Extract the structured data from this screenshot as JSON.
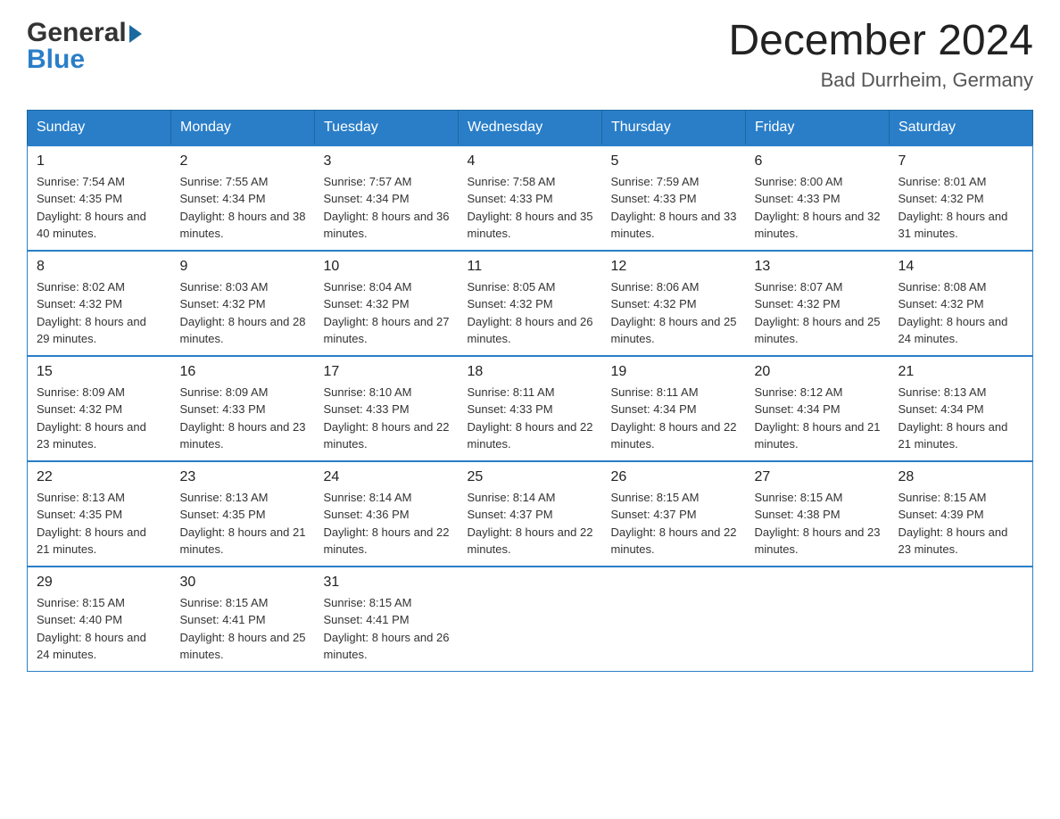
{
  "header": {
    "logo_general": "General",
    "logo_blue": "Blue",
    "title": "December 2024",
    "subtitle": "Bad Durrheim, Germany"
  },
  "calendar": {
    "days_of_week": [
      "Sunday",
      "Monday",
      "Tuesday",
      "Wednesday",
      "Thursday",
      "Friday",
      "Saturday"
    ],
    "weeks": [
      [
        {
          "day": "1",
          "sunrise": "7:54 AM",
          "sunset": "4:35 PM",
          "daylight": "8 hours and 40 minutes."
        },
        {
          "day": "2",
          "sunrise": "7:55 AM",
          "sunset": "4:34 PM",
          "daylight": "8 hours and 38 minutes."
        },
        {
          "day": "3",
          "sunrise": "7:57 AM",
          "sunset": "4:34 PM",
          "daylight": "8 hours and 36 minutes."
        },
        {
          "day": "4",
          "sunrise": "7:58 AM",
          "sunset": "4:33 PM",
          "daylight": "8 hours and 35 minutes."
        },
        {
          "day": "5",
          "sunrise": "7:59 AM",
          "sunset": "4:33 PM",
          "daylight": "8 hours and 33 minutes."
        },
        {
          "day": "6",
          "sunrise": "8:00 AM",
          "sunset": "4:33 PM",
          "daylight": "8 hours and 32 minutes."
        },
        {
          "day": "7",
          "sunrise": "8:01 AM",
          "sunset": "4:32 PM",
          "daylight": "8 hours and 31 minutes."
        }
      ],
      [
        {
          "day": "8",
          "sunrise": "8:02 AM",
          "sunset": "4:32 PM",
          "daylight": "8 hours and 29 minutes."
        },
        {
          "day": "9",
          "sunrise": "8:03 AM",
          "sunset": "4:32 PM",
          "daylight": "8 hours and 28 minutes."
        },
        {
          "day": "10",
          "sunrise": "8:04 AM",
          "sunset": "4:32 PM",
          "daylight": "8 hours and 27 minutes."
        },
        {
          "day": "11",
          "sunrise": "8:05 AM",
          "sunset": "4:32 PM",
          "daylight": "8 hours and 26 minutes."
        },
        {
          "day": "12",
          "sunrise": "8:06 AM",
          "sunset": "4:32 PM",
          "daylight": "8 hours and 25 minutes."
        },
        {
          "day": "13",
          "sunrise": "8:07 AM",
          "sunset": "4:32 PM",
          "daylight": "8 hours and 25 minutes."
        },
        {
          "day": "14",
          "sunrise": "8:08 AM",
          "sunset": "4:32 PM",
          "daylight": "8 hours and 24 minutes."
        }
      ],
      [
        {
          "day": "15",
          "sunrise": "8:09 AM",
          "sunset": "4:32 PM",
          "daylight": "8 hours and 23 minutes."
        },
        {
          "day": "16",
          "sunrise": "8:09 AM",
          "sunset": "4:33 PM",
          "daylight": "8 hours and 23 minutes."
        },
        {
          "day": "17",
          "sunrise": "8:10 AM",
          "sunset": "4:33 PM",
          "daylight": "8 hours and 22 minutes."
        },
        {
          "day": "18",
          "sunrise": "8:11 AM",
          "sunset": "4:33 PM",
          "daylight": "8 hours and 22 minutes."
        },
        {
          "day": "19",
          "sunrise": "8:11 AM",
          "sunset": "4:34 PM",
          "daylight": "8 hours and 22 minutes."
        },
        {
          "day": "20",
          "sunrise": "8:12 AM",
          "sunset": "4:34 PM",
          "daylight": "8 hours and 21 minutes."
        },
        {
          "day": "21",
          "sunrise": "8:13 AM",
          "sunset": "4:34 PM",
          "daylight": "8 hours and 21 minutes."
        }
      ],
      [
        {
          "day": "22",
          "sunrise": "8:13 AM",
          "sunset": "4:35 PM",
          "daylight": "8 hours and 21 minutes."
        },
        {
          "day": "23",
          "sunrise": "8:13 AM",
          "sunset": "4:35 PM",
          "daylight": "8 hours and 21 minutes."
        },
        {
          "day": "24",
          "sunrise": "8:14 AM",
          "sunset": "4:36 PM",
          "daylight": "8 hours and 22 minutes."
        },
        {
          "day": "25",
          "sunrise": "8:14 AM",
          "sunset": "4:37 PM",
          "daylight": "8 hours and 22 minutes."
        },
        {
          "day": "26",
          "sunrise": "8:15 AM",
          "sunset": "4:37 PM",
          "daylight": "8 hours and 22 minutes."
        },
        {
          "day": "27",
          "sunrise": "8:15 AM",
          "sunset": "4:38 PM",
          "daylight": "8 hours and 23 minutes."
        },
        {
          "day": "28",
          "sunrise": "8:15 AM",
          "sunset": "4:39 PM",
          "daylight": "8 hours and 23 minutes."
        }
      ],
      [
        {
          "day": "29",
          "sunrise": "8:15 AM",
          "sunset": "4:40 PM",
          "daylight": "8 hours and 24 minutes."
        },
        {
          "day": "30",
          "sunrise": "8:15 AM",
          "sunset": "4:41 PM",
          "daylight": "8 hours and 25 minutes."
        },
        {
          "day": "31",
          "sunrise": "8:15 AM",
          "sunset": "4:41 PM",
          "daylight": "8 hours and 26 minutes."
        },
        null,
        null,
        null,
        null
      ]
    ]
  }
}
